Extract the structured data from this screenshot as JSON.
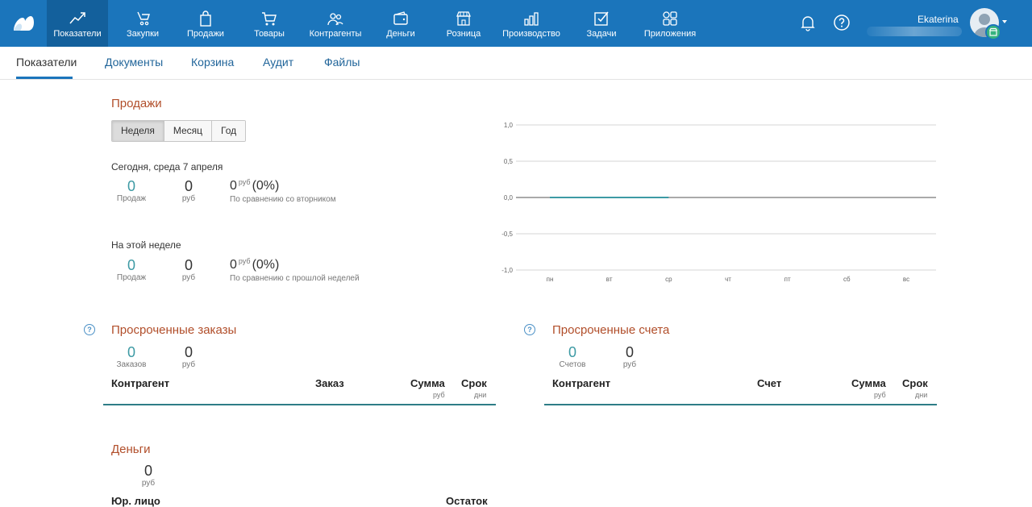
{
  "nav": {
    "items": [
      {
        "label": "Показатели",
        "icon": "chart-line-icon"
      },
      {
        "label": "Закупки",
        "icon": "purchase-icon"
      },
      {
        "label": "Продажи",
        "icon": "shopping-bag-icon"
      },
      {
        "label": "Товары",
        "icon": "cart-icon"
      },
      {
        "label": "Контрагенты",
        "icon": "people-icon"
      },
      {
        "label": "Деньги",
        "icon": "wallet-icon"
      },
      {
        "label": "Розница",
        "icon": "store-icon"
      },
      {
        "label": "Производство",
        "icon": "factory-icon"
      },
      {
        "label": "Задачи",
        "icon": "checkbox-icon"
      },
      {
        "label": "Приложения",
        "icon": "apps-icon"
      }
    ],
    "username": "Ekaterina"
  },
  "subtabs": [
    "Показатели",
    "Документы",
    "Корзина",
    "Аудит",
    "Файлы"
  ],
  "sales": {
    "title": "Продажи",
    "periods": [
      "Неделя",
      "Месяц",
      "Год"
    ],
    "selected_period": "Неделя",
    "today": {
      "heading": "Сегодня, среда 7 апреля",
      "count": "0",
      "count_caption": "Продаж",
      "amount": "0",
      "amount_caption": "руб",
      "compare_value": "0",
      "compare_unit": "руб",
      "compare_pct": "(0%)",
      "compare_caption": "По сравнению со вторником"
    },
    "week": {
      "heading": "На этой неделе",
      "count": "0",
      "count_caption": "Продаж",
      "amount": "0",
      "amount_caption": "руб",
      "compare_value": "0",
      "compare_unit": "руб",
      "compare_pct": "(0%)",
      "compare_caption": "По сравнению с прошлой неделей"
    }
  },
  "chart_data": {
    "type": "line",
    "categories": [
      "пн",
      "вт",
      "ср",
      "чт",
      "пт",
      "сб",
      "вс"
    ],
    "series": [
      {
        "values": [
          0,
          0,
          0,
          null,
          null,
          null,
          null
        ]
      }
    ],
    "y_ticks": [
      "1,0",
      "0,5",
      "0,0",
      "-0,5",
      "-1,0"
    ],
    "ylim": [
      -1,
      1
    ],
    "grid": true,
    "color": "#3d9aa4"
  },
  "overdue_orders": {
    "title": "Просроченные заказы",
    "count": "0",
    "count_caption": "Заказов",
    "amount": "0",
    "amount_caption": "руб",
    "columns": {
      "counterparty": "Контрагент",
      "order": "Заказ",
      "sum": "Сумма",
      "sum_unit": "руб",
      "term": "Срок",
      "term_unit": "дни"
    }
  },
  "overdue_invoices": {
    "title": "Просроченные счета",
    "count": "0",
    "count_caption": "Счетов",
    "amount": "0",
    "amount_caption": "руб",
    "columns": {
      "counterparty": "Контрагент",
      "invoice": "Счет",
      "sum": "Сумма",
      "sum_unit": "руб",
      "term": "Срок",
      "term_unit": "дни"
    }
  },
  "money": {
    "title": "Деньги",
    "amount": "0",
    "amount_caption": "руб",
    "columns": {
      "entity": "Юр. лицо",
      "balance": "Остаток"
    }
  },
  "help_glyph": "?",
  "colors": {
    "nav_bg": "#1b75bb",
    "nav_active": "#13609c",
    "section_title": "#b14e2a",
    "teal": "#3d9aa4"
  }
}
